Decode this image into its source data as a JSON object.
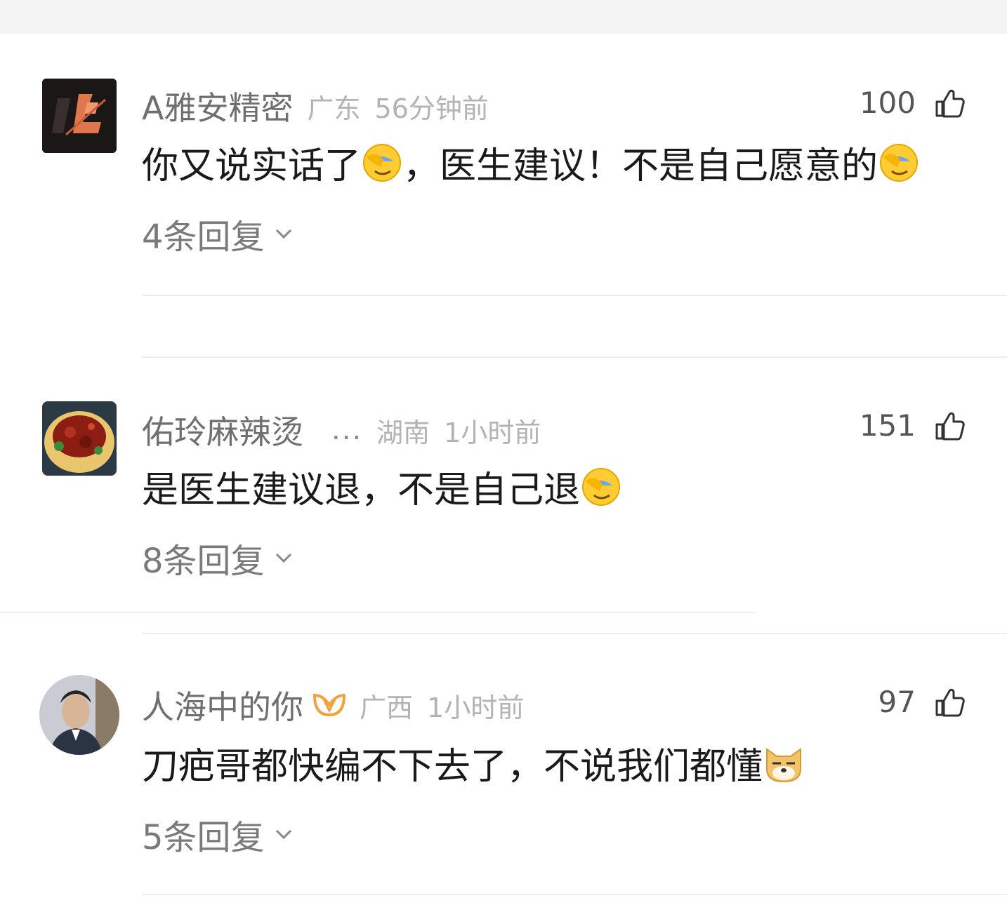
{
  "comments": [
    {
      "username": "A雅安精密",
      "location": "广东",
      "time": "56分钟前",
      "likes": "100",
      "text_parts": [
        "你又说实话了",
        "，医生建议！不是自己愿意的"
      ],
      "replies": "4条回复"
    },
    {
      "username": "佑玲麻辣烫",
      "ellipsis": "...",
      "location": "湖南",
      "time": "1小时前",
      "likes": "151",
      "text_parts": [
        "是医生建议退，不是自己退"
      ],
      "replies": "8条回复"
    },
    {
      "username": "人海中的你",
      "location": "广西",
      "time": "1小时前",
      "likes": "97",
      "text_parts": [
        "刀疤哥都快编不下去了，不说我们都懂"
      ],
      "replies": "5条回复"
    }
  ],
  "colors": {
    "username": "#6f6f6f",
    "meta": "#b3b3b3",
    "text": "#1a1a1a",
    "badge": "#f2a23a"
  },
  "icons": {
    "like": "thumbs-up-icon",
    "chevron": "chevron-down-icon",
    "facepalm": "facepalm-emoji",
    "doge": "doge-emoji",
    "badge": "vip-badge-icon"
  }
}
